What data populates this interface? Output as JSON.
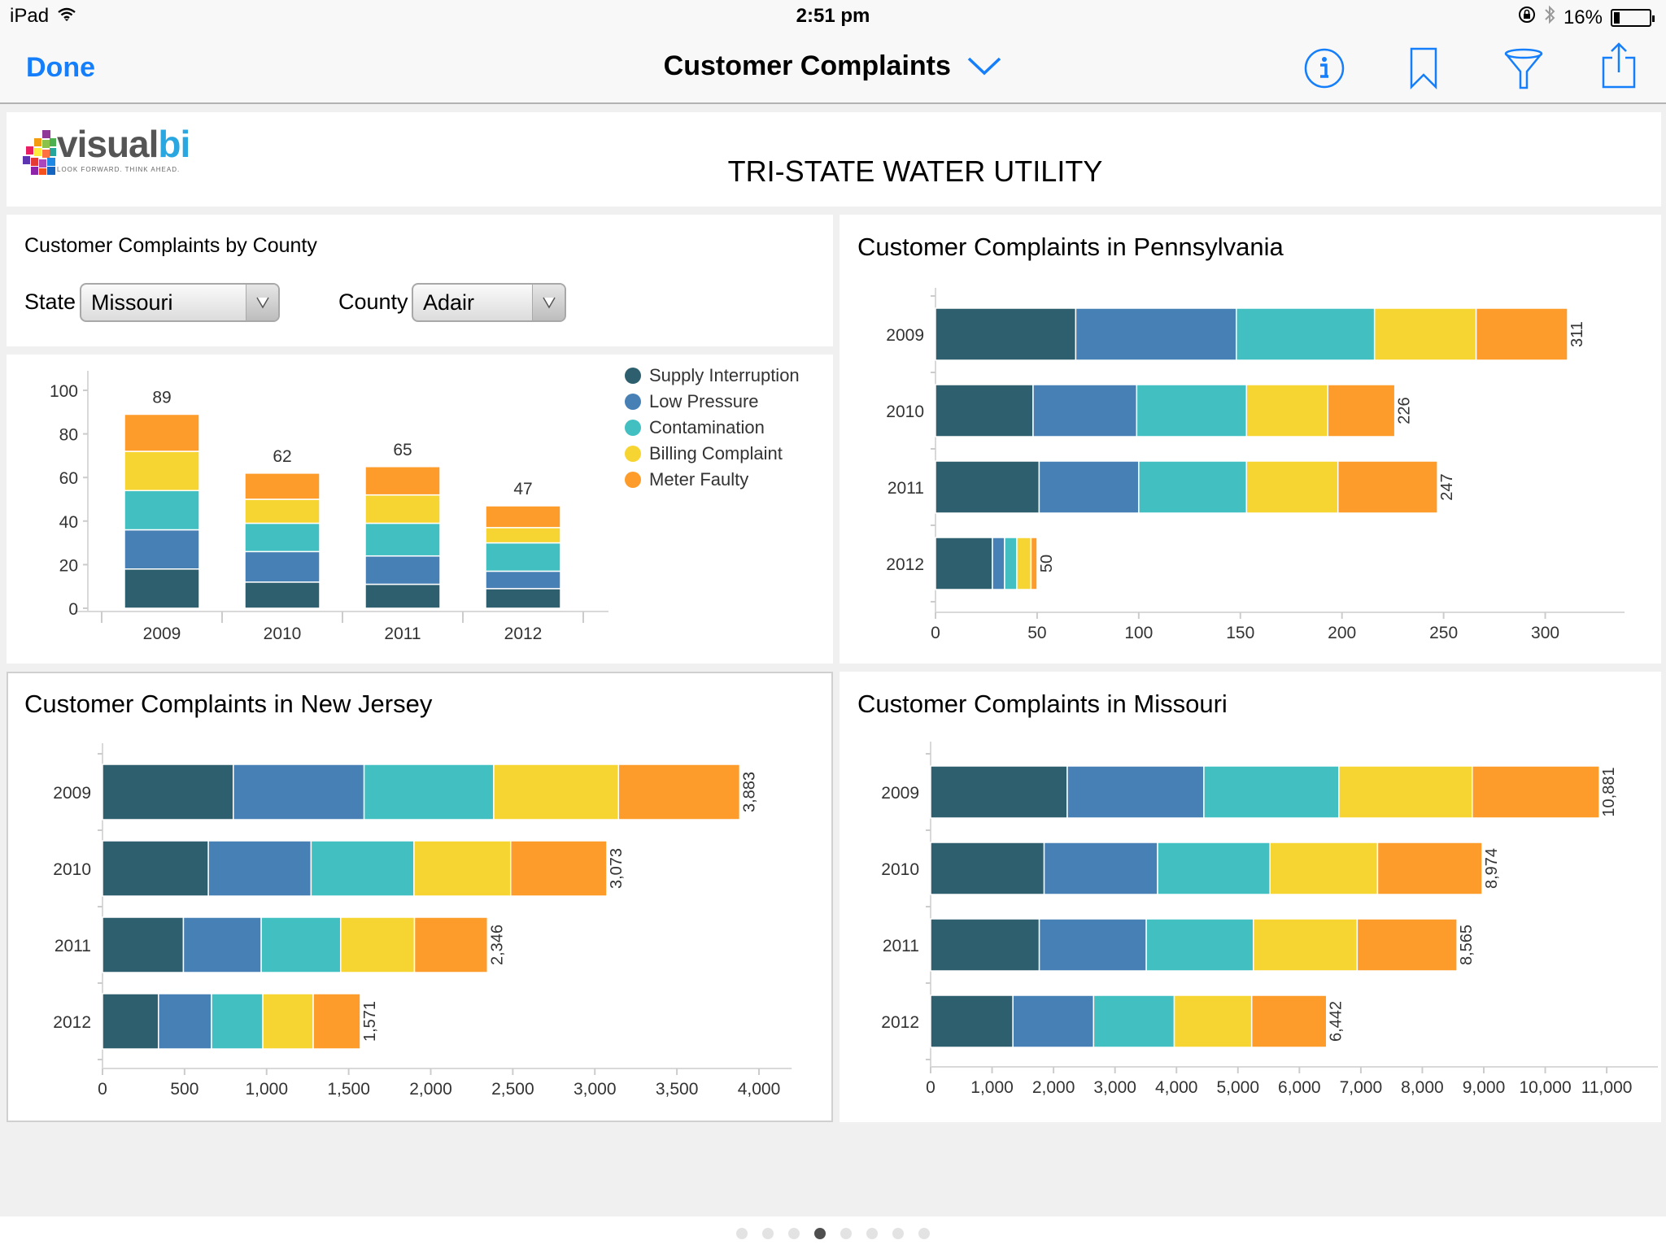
{
  "status_bar": {
    "device": "iPad",
    "time": "2:51 pm",
    "battery_percent": "16%",
    "battery_level": 0.16
  },
  "nav": {
    "done_label": "Done",
    "title": "Customer Complaints",
    "icons": [
      "info-icon",
      "bookmark-icon",
      "filter-icon",
      "share-icon"
    ],
    "accent_color": "#147efb"
  },
  "header": {
    "logo_text_main": "visual",
    "logo_text_bi": "bi",
    "logo_tagline": "LOOK FORWARD. THINK AHEAD.",
    "title": "TRI-STATE WATER UTILITY"
  },
  "selector": {
    "title": "Customer Complaints by County",
    "state_label": "State",
    "state_value": "Missouri",
    "county_label": "County",
    "county_value": "Adair"
  },
  "legend": [
    {
      "name": "Supply Interruption",
      "color": "#2e5f6f"
    },
    {
      "name": "Low Pressure",
      "color": "#4680b5"
    },
    {
      "name": "Contamination",
      "color": "#41bfc1"
    },
    {
      "name": "Billing Complaint",
      "color": "#f6d533"
    },
    {
      "name": "Meter Faulty",
      "color": "#fd9c2a"
    }
  ],
  "chart_data": [
    {
      "id": "county",
      "type": "bar",
      "orientation": "vertical",
      "stacked": true,
      "title": "",
      "categories": [
        "2009",
        "2010",
        "2011",
        "2012"
      ],
      "series": [
        {
          "name": "Supply Interruption",
          "values": [
            18,
            12,
            11,
            9
          ]
        },
        {
          "name": "Low Pressure",
          "values": [
            18,
            14,
            13,
            8
          ]
        },
        {
          "name": "Contamination",
          "values": [
            18,
            13,
            15,
            13
          ]
        },
        {
          "name": "Billing Complaint",
          "values": [
            18,
            11,
            13,
            7
          ]
        },
        {
          "name": "Meter Faulty",
          "values": [
            17,
            12,
            13,
            10
          ]
        }
      ],
      "totals": [
        "89",
        "62",
        "65",
        "47"
      ],
      "ylim": [
        0,
        100
      ],
      "yticks": [
        "0",
        "20",
        "40",
        "60",
        "80",
        "100"
      ],
      "legend": "top-right"
    },
    {
      "id": "pa",
      "type": "bar",
      "orientation": "horizontal",
      "stacked": true,
      "title": "Customer Complaints in Pennsylvania",
      "categories": [
        "2009",
        "2010",
        "2011",
        "2012"
      ],
      "series": [
        {
          "name": "Supply Interruption",
          "values": [
            69,
            48,
            51,
            28
          ]
        },
        {
          "name": "Low Pressure",
          "values": [
            79,
            51,
            49,
            6
          ]
        },
        {
          "name": "Contamination",
          "values": [
            68,
            54,
            53,
            6
          ]
        },
        {
          "name": "Billing Complaint",
          "values": [
            50,
            40,
            45,
            7
          ]
        },
        {
          "name": "Meter Faulty",
          "values": [
            45,
            33,
            49,
            3
          ]
        }
      ],
      "totals": [
        "311",
        "226",
        "247",
        "50"
      ],
      "xlim": [
        0,
        335
      ],
      "xticks": [
        "0",
        "50",
        "100",
        "150",
        "200",
        "250",
        "300"
      ],
      "xtick_values": [
        0,
        50,
        100,
        150,
        200,
        250,
        300
      ]
    },
    {
      "id": "nj",
      "type": "bar",
      "orientation": "horizontal",
      "stacked": true,
      "title": "Customer Complaints in New Jersey",
      "categories": [
        "2009",
        "2010",
        "2011",
        "2012"
      ],
      "series": [
        {
          "name": "Supply Interruption",
          "values": [
            797,
            645,
            493,
            341
          ]
        },
        {
          "name": "Low Pressure",
          "values": [
            797,
            626,
            474,
            323
          ]
        },
        {
          "name": "Contamination",
          "values": [
            790,
            627,
            484,
            313
          ]
        },
        {
          "name": "Billing Complaint",
          "values": [
            760,
            589,
            450,
            307
          ]
        },
        {
          "name": "Meter Faulty",
          "values": [
            739,
            586,
            445,
            287
          ]
        }
      ],
      "totals": [
        "3,883",
        "3,073",
        "2,346",
        "1,571"
      ],
      "xlim": [
        0,
        4150
      ],
      "xticks": [
        "0",
        "500",
        "1,000",
        "1,500",
        "2,000",
        "2,500",
        "3,000",
        "3,500",
        "4,000"
      ],
      "xtick_values": [
        0,
        500,
        1000,
        1500,
        2000,
        2500,
        3000,
        3500,
        4000
      ]
    },
    {
      "id": "mo",
      "type": "bar",
      "orientation": "horizontal",
      "stacked": true,
      "title": "Customer Complaints in Missouri",
      "categories": [
        "2009",
        "2010",
        "2011",
        "2012"
      ],
      "series": [
        {
          "name": "Supply Interruption",
          "values": [
            2223,
            1847,
            1768,
            1339
          ]
        },
        {
          "name": "Low Pressure",
          "values": [
            2223,
            1846,
            1741,
            1313
          ]
        },
        {
          "name": "Contamination",
          "values": [
            2196,
            1829,
            1742,
            1312
          ]
        },
        {
          "name": "Billing Complaint",
          "values": [
            2170,
            1750,
            1689,
            1260
          ]
        },
        {
          "name": "Meter Faulty",
          "values": [
            2069,
            1702,
            1625,
            1218
          ]
        }
      ],
      "totals": [
        "10,881",
        "8,974",
        "8,565",
        "6,442"
      ],
      "xlim": [
        0,
        11700
      ],
      "xticks": [
        "0",
        "1,000",
        "2,000",
        "3,000",
        "4,000",
        "5,000",
        "6,000",
        "7,000",
        "8,000",
        "9,000",
        "10,000",
        "11,000"
      ],
      "xtick_values": [
        0,
        1000,
        2000,
        3000,
        4000,
        5000,
        6000,
        7000,
        8000,
        9000,
        10000,
        11000
      ]
    }
  ],
  "pager": {
    "count": 8,
    "active_index": 3
  }
}
